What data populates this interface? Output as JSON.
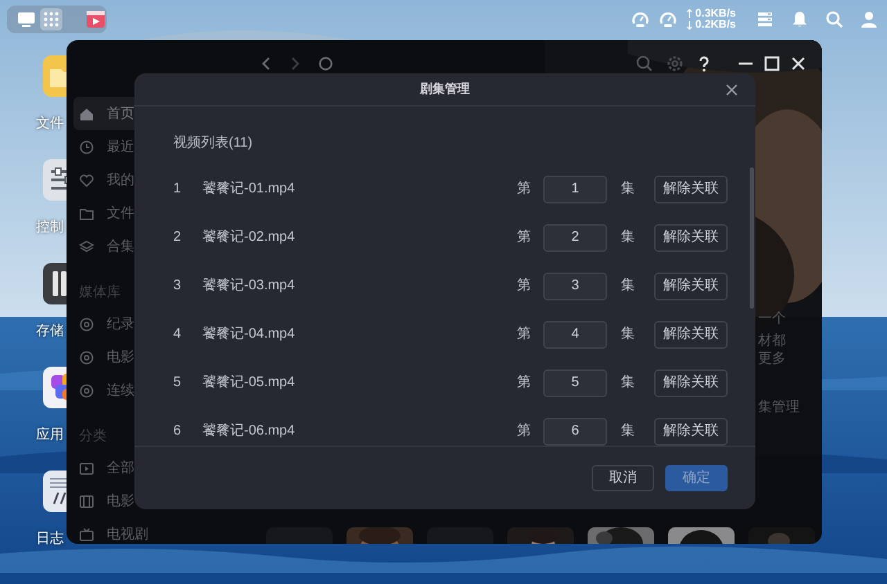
{
  "taskbar": {
    "items": [
      {
        "selected": false
      },
      {
        "selected": true
      },
      {
        "selected": false
      }
    ]
  },
  "tray": {
    "upload": "0.3KB/s",
    "download": "0.2KB/s"
  },
  "desktop_icons": [
    {
      "label": "文件"
    },
    {
      "label": "控制"
    },
    {
      "label": "存储"
    },
    {
      "label": "应用"
    },
    {
      "label": "日志"
    }
  ],
  "app_window": {
    "sidebar": [
      {
        "kind": "item",
        "label": "首页",
        "selected": true
      },
      {
        "kind": "item",
        "label": "最近",
        "selected": false
      },
      {
        "kind": "item",
        "label": "我的",
        "selected": false
      },
      {
        "kind": "item",
        "label": "文件",
        "selected": false
      },
      {
        "kind": "item",
        "label": "合集",
        "selected": false
      },
      {
        "kind": "section",
        "label": "媒体库"
      },
      {
        "kind": "item",
        "label": "纪录",
        "selected": false
      },
      {
        "kind": "item",
        "label": "电影",
        "selected": false
      },
      {
        "kind": "item",
        "label": "连续",
        "selected": false
      },
      {
        "kind": "section",
        "label": "分类"
      },
      {
        "kind": "item",
        "label": "全部",
        "selected": false
      },
      {
        "kind": "item",
        "label": "电影",
        "selected": false
      },
      {
        "kind": "item",
        "label": "电视剧",
        "selected": false
      }
    ],
    "content_texts": [
      "一个",
      "材都",
      "更多",
      "集管理"
    ]
  },
  "dialog": {
    "title": "剧集管理",
    "list_title": "视频列表(11)",
    "rows": [
      {
        "index": "1",
        "file": "饕餮记-01.mp4",
        "prefix": "第",
        "episode": "1",
        "suffix": "集",
        "action": "解除关联"
      },
      {
        "index": "2",
        "file": "饕餮记-02.mp4",
        "prefix": "第",
        "episode": "2",
        "suffix": "集",
        "action": "解除关联"
      },
      {
        "index": "3",
        "file": "饕餮记-03.mp4",
        "prefix": "第",
        "episode": "3",
        "suffix": "集",
        "action": "解除关联"
      },
      {
        "index": "4",
        "file": "饕餮记-04.mp4",
        "prefix": "第",
        "episode": "4",
        "suffix": "集",
        "action": "解除关联"
      },
      {
        "index": "5",
        "file": "饕餮记-05.mp4",
        "prefix": "第",
        "episode": "5",
        "suffix": "集",
        "action": "解除关联"
      },
      {
        "index": "6",
        "file": "饕餮记-06.mp4",
        "prefix": "第",
        "episode": "6",
        "suffix": "集",
        "action": "解除关联"
      }
    ],
    "buttons": [
      {
        "label": "取消",
        "kind": "secondary",
        "disabled": false
      },
      {
        "label": "确定",
        "kind": "primary",
        "disabled": true
      }
    ]
  }
}
